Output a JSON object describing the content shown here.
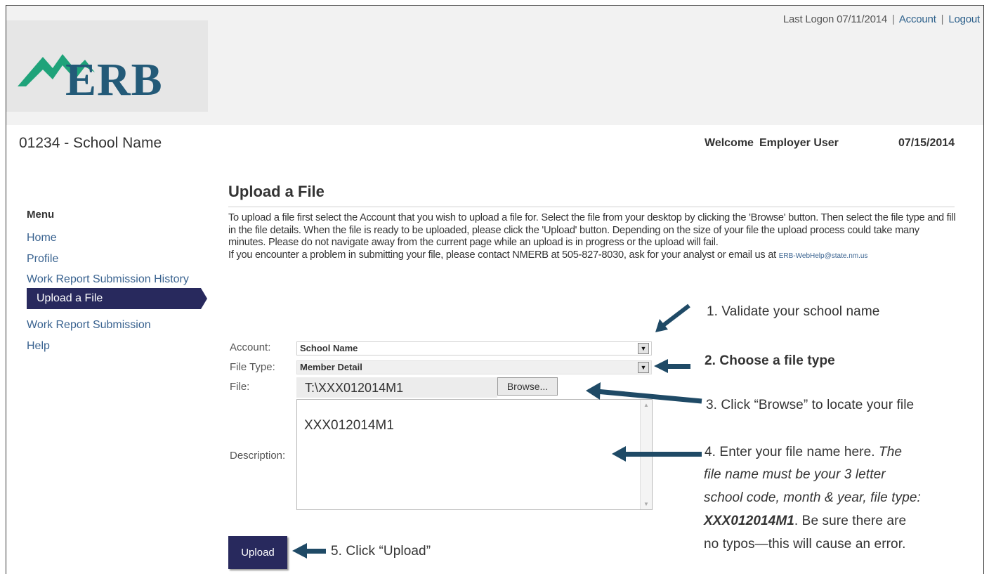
{
  "header": {
    "logo_text": "ERB",
    "last_logon": "Last Logon 07/11/2014",
    "account_link": "Account",
    "logout_link": "Logout",
    "separator": "|"
  },
  "subheader": {
    "school": "01234 - School Name",
    "welcome_label": "Welcome",
    "user_name": "Employer User",
    "date": "07/15/2014"
  },
  "menu": {
    "title": "Menu",
    "items": [
      {
        "label": "Home"
      },
      {
        "label": "Profile"
      },
      {
        "label": "Work Report Submission History"
      },
      {
        "label": "Upload a File",
        "active": true
      },
      {
        "label": "Work Report Submission"
      },
      {
        "label": "Help"
      }
    ]
  },
  "page": {
    "title": "Upload a File",
    "instructions_1": "To upload a file first select the Account that you wish to upload a file for. Select the file from your desktop by clicking the 'Browse' button. Then select the file type and fill in the file details. When the file is ready to be uploaded, please click the 'Upload' button. Depending on the size of your file the upload process could take many minutes. Please do not navigate away from the current page while an upload is in progress or the upload will fail.",
    "instructions_2": "If you encounter a problem in submitting your file, please contact NMERB at 505-827-8030, ask for your analyst or email us at",
    "email": "ERB-WebHelp@state.nm.us"
  },
  "form": {
    "account_label": "Account:",
    "account_value": "School Name",
    "file_type_label": "File Type:",
    "file_type_value": "Member Detail",
    "file_label": "File:",
    "file_value": "T:\\XXX012014M1",
    "browse_label": "Browse...",
    "description_label": "Description:",
    "description_value": "XXX012014M1",
    "upload_label": "Upload"
  },
  "callouts": {
    "c1": "1. Validate your school name",
    "c2": "2. Choose a file type",
    "c3": "3. Click “Browse” to locate your file",
    "c4_a": "4. Enter your file name here.",
    "c4_b": "The",
    "c4_c": "file name must be your 3 letter",
    "c4_d": "school code, month & year, file type:",
    "c4_e": "XXX012014M1",
    "c4_f": ". Be sure there are",
    "c4_g": "no typos—this will cause an error.",
    "c5": "5. Click “Upload”"
  },
  "colors": {
    "nav_active": "#28295d",
    "logo_green": "#1fa37a",
    "logo_blue": "#235a78",
    "link": "#3a6390",
    "arrow": "#1f4a66"
  },
  "icons": {
    "dropdown": "triangle-down",
    "scroll_up": "triangle-up",
    "scroll_down": "triangle-down"
  }
}
